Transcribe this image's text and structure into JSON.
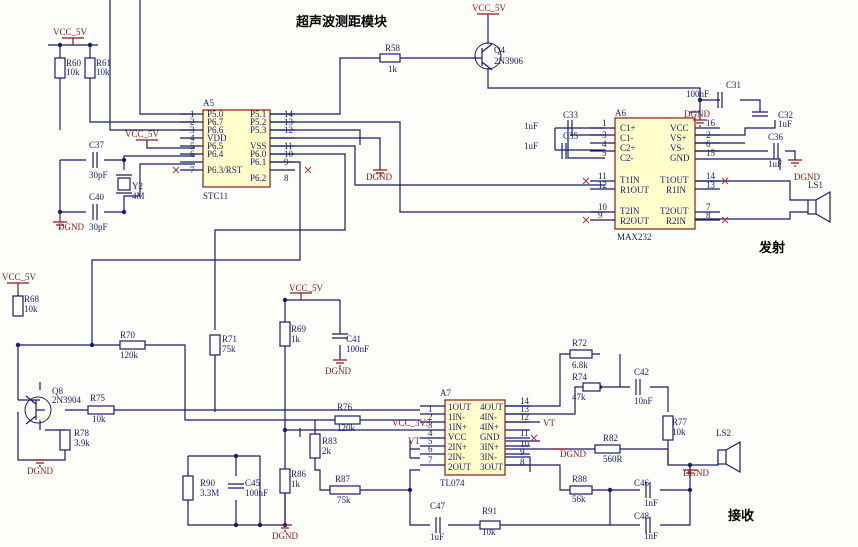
{
  "titles": {
    "module": "超声波测距模块",
    "transmit": "发射",
    "receive": "接收"
  },
  "power": {
    "vcc5": "VCC_5V",
    "vcc3v3": "VCC_3V3",
    "dgnd": "DGND",
    "vt": "VT"
  },
  "a5": {
    "ref": "A5",
    "part": "STC11",
    "left_pins": [
      {
        "num": "1",
        "name": "P5.0"
      },
      {
        "num": "2",
        "name": "P6.7"
      },
      {
        "num": "3",
        "name": "P6.6"
      },
      {
        "num": "4",
        "name": "VDD"
      },
      {
        "num": "5",
        "name": "P6.5"
      },
      {
        "num": "6",
        "name": "P6.4"
      },
      {
        "num": "7",
        "name": "P6.3/RST"
      }
    ],
    "right_pins": [
      {
        "num": "14",
        "name": "P5.1"
      },
      {
        "num": "13",
        "name": "P5.2"
      },
      {
        "num": "12",
        "name": "P5.3"
      },
      {
        "num": "11",
        "name": "VSS"
      },
      {
        "num": "10",
        "name": "P6.0"
      },
      {
        "num": "9",
        "name": "P6.1"
      },
      {
        "num": "8",
        "name": "P6.2"
      }
    ]
  },
  "a6": {
    "ref": "A6",
    "part": "MAX232",
    "left_pins": [
      {
        "num": "1",
        "name": "C1+"
      },
      {
        "num": "3",
        "name": "C1-"
      },
      {
        "num": "4",
        "name": "C2+"
      },
      {
        "num": "5",
        "name": "C2-"
      },
      {
        "num": "11",
        "name": "T1IN"
      },
      {
        "num": "12",
        "name": "R1OUT"
      },
      {
        "num": "10",
        "name": "T2IN"
      },
      {
        "num": "9",
        "name": "R2OUT"
      }
    ],
    "right_pins": [
      {
        "num": "16",
        "name": "VCC"
      },
      {
        "num": "2",
        "name": "VS+"
      },
      {
        "num": "6",
        "name": "VS-"
      },
      {
        "num": "15",
        "name": "GND"
      },
      {
        "num": "14",
        "name": "T1OUT"
      },
      {
        "num": "13",
        "name": "R1IN"
      },
      {
        "num": "7",
        "name": "T2OUT"
      },
      {
        "num": "8",
        "name": "R2IN"
      }
    ]
  },
  "a7": {
    "ref": "A7",
    "part": "TL074",
    "left_pins": [
      {
        "num": "1",
        "name": "1OUT"
      },
      {
        "num": "2",
        "name": "1IN-"
      },
      {
        "num": "3",
        "name": "1IN+"
      },
      {
        "num": "4",
        "name": "VCC"
      },
      {
        "num": "5",
        "name": "2IN+"
      },
      {
        "num": "6",
        "name": "2IN-"
      },
      {
        "num": "7",
        "name": "2OUT"
      }
    ],
    "right_pins": [
      {
        "num": "14",
        "name": "4OUT"
      },
      {
        "num": "13",
        "name": "4IN-"
      },
      {
        "num": "12",
        "name": "4IN+"
      },
      {
        "num": "11",
        "name": "GND"
      },
      {
        "num": "10",
        "name": "3IN+"
      },
      {
        "num": "9",
        "name": "3IN-"
      },
      {
        "num": "8",
        "name": "3OUT"
      }
    ]
  },
  "parts": {
    "r60": {
      "ref": "R60",
      "val": "10k"
    },
    "r61": {
      "ref": "R61",
      "val": "10k"
    },
    "r58": {
      "ref": "R58",
      "val": "1k"
    },
    "q4": {
      "ref": "Q4",
      "val": "2N3906"
    },
    "c37": {
      "ref": "C37",
      "val": "30pF"
    },
    "c40": {
      "ref": "C40",
      "val": "30pF"
    },
    "y2": {
      "ref": "Y2",
      "val": "4M"
    },
    "c31": {
      "ref": "C31",
      "val": "100nF"
    },
    "c32": {
      "ref": "C32",
      "val": "1uF"
    },
    "c33": {
      "ref": "C33",
      "val": "1uF"
    },
    "c35": {
      "ref": "C35",
      "val": "1uF"
    },
    "c36": {
      "ref": "C36",
      "val": "1uF"
    },
    "ls1": {
      "ref": "LS1"
    },
    "r68": {
      "ref": "R68",
      "val": "10k"
    },
    "r70": {
      "ref": "R70",
      "val": "120k"
    },
    "q8": {
      "ref": "Q8",
      "val": "2N3904"
    },
    "r75": {
      "ref": "R75",
      "val": "10k"
    },
    "r78": {
      "ref": "R78",
      "val": "3.9k"
    },
    "r71": {
      "ref": "R71",
      "val": "75k"
    },
    "r69": {
      "ref": "R69",
      "val": "1k"
    },
    "c41": {
      "ref": "C41",
      "val": "100nF"
    },
    "r76": {
      "ref": "R76",
      "val": "120k"
    },
    "r83": {
      "ref": "R83",
      "val": "2k"
    },
    "r90": {
      "ref": "R90",
      "val": "3.3M"
    },
    "c45": {
      "ref": "C45",
      "val": "100nF"
    },
    "r86": {
      "ref": "R86",
      "val": "1k"
    },
    "r87": {
      "ref": "R87",
      "val": "75k"
    },
    "c47": {
      "ref": "C47",
      "val": "1uF"
    },
    "r91": {
      "ref": "R91",
      "val": "10k"
    },
    "r72": {
      "ref": "R72",
      "val": "6.8k"
    },
    "r74": {
      "ref": "R74",
      "val": "47k"
    },
    "c42": {
      "ref": "C42",
      "val": "10nF"
    },
    "r77": {
      "ref": "R77",
      "val": "10k"
    },
    "r82": {
      "ref": "R82",
      "val": "560R"
    },
    "ls2": {
      "ref": "LS2"
    },
    "r88": {
      "ref": "R88",
      "val": "56k"
    },
    "c46": {
      "ref": "C46",
      "val": "1nF"
    },
    "c48": {
      "ref": "C48",
      "val": "1nF"
    }
  }
}
